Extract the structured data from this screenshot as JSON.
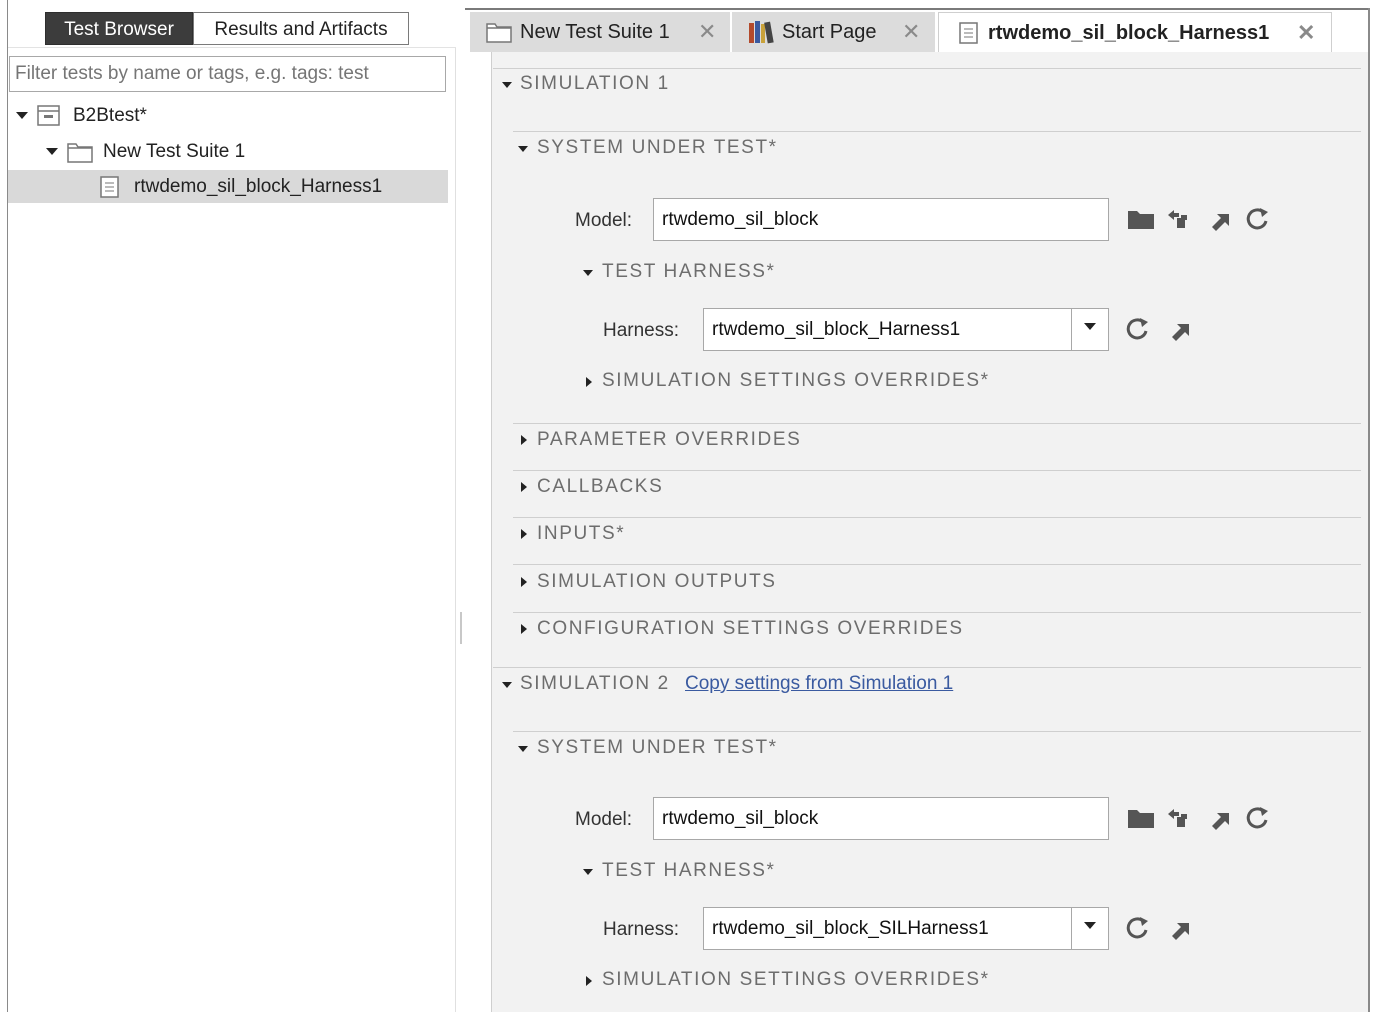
{
  "left_panel": {
    "tabs": {
      "test_browser": "Test Browser",
      "results": "Results and Artifacts"
    },
    "filter_placeholder": "Filter tests by name or tags, e.g. tags: test",
    "tree": {
      "root": "B2Btest*",
      "suite": "New Test Suite 1",
      "test_case": "rtwdemo_sil_block_Harness1"
    }
  },
  "document_tabs": [
    {
      "label": "New Test Suite 1",
      "icon": "folder-icon"
    },
    {
      "label": "Start Page",
      "icon": "books-icon"
    },
    {
      "label": "rtwdemo_sil_block_Harness1",
      "icon": "document-icon"
    }
  ],
  "close_glyph": "✕",
  "sim1": {
    "title": "SIMULATION 1",
    "sut_title": "SYSTEM UNDER TEST*",
    "model_label": "Model:",
    "model_value": "rtwdemo_sil_block",
    "harness_section": "TEST HARNESS*",
    "harness_label": "Harness:",
    "harness_value": "rtwdemo_sil_block_Harness1",
    "sim_settings": "SIMULATION SETTINGS OVERRIDES*",
    "sections": [
      "PARAMETER OVERRIDES",
      "CALLBACKS",
      "INPUTS*",
      "SIMULATION OUTPUTS",
      "CONFIGURATION SETTINGS OVERRIDES"
    ]
  },
  "sim2": {
    "title": "SIMULATION 2",
    "copy_link": "Copy settings from Simulation 1",
    "sut_title": "SYSTEM UNDER TEST*",
    "model_label": "Model:",
    "model_value": "rtwdemo_sil_block",
    "harness_section": "TEST HARNESS*",
    "harness_label": "Harness:",
    "harness_value": "rtwdemo_sil_block_SILHarness1",
    "sim_settings": "SIMULATION SETTINGS OVERRIDES*"
  },
  "colors": {
    "icon_dark": "#555555",
    "link": "#3a5aa0",
    "section_text": "#6d6d6d"
  }
}
